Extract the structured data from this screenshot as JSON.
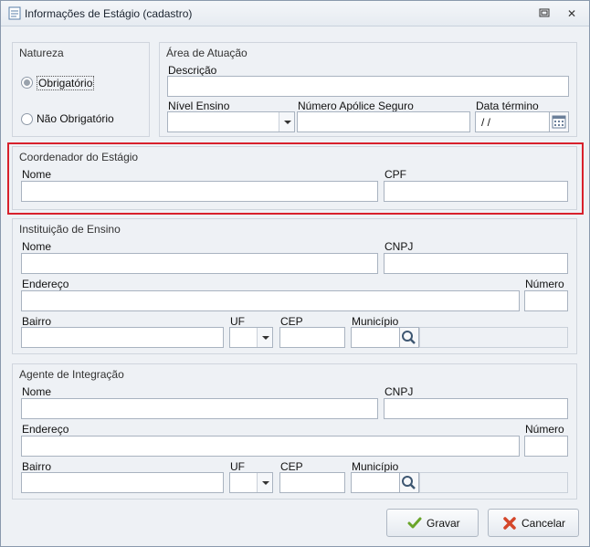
{
  "window": {
    "title": "Informações de Estágio (cadastro)"
  },
  "natureza": {
    "title": "Natureza",
    "options": [
      "Obrigatório",
      "Não Obrigatório"
    ],
    "selected": "Obrigatório"
  },
  "area": {
    "title": "Área de Atuação",
    "descricao_label": "Descrição",
    "nivel_label": "Nível Ensino",
    "apolice_label": "Número Apólice Seguro",
    "data_label": "Data término",
    "data_value": "/ /"
  },
  "coordenador": {
    "title": "Coordenador do Estágio",
    "nome_label": "Nome",
    "cpf_label": "CPF"
  },
  "instituicao": {
    "title": "Instituição de Ensino",
    "nome_label": "Nome",
    "cnpj_label": "CNPJ",
    "endereco_label": "Endereço",
    "numero_label": "Número",
    "bairro_label": "Bairro",
    "uf_label": "UF",
    "cep_label": "CEP",
    "municipio_label": "Município"
  },
  "agente": {
    "title": "Agente de Integração",
    "nome_label": "Nome",
    "cnpj_label": "CNPJ",
    "endereco_label": "Endereço",
    "numero_label": "Número",
    "bairro_label": "Bairro",
    "uf_label": "UF",
    "cep_label": "CEP",
    "municipio_label": "Município"
  },
  "buttons": {
    "gravar": "Gravar",
    "cancelar": "Cancelar"
  },
  "colors": {
    "highlight": "#d8212c",
    "check": "#6aa52a",
    "cancel": "#d4462a"
  }
}
